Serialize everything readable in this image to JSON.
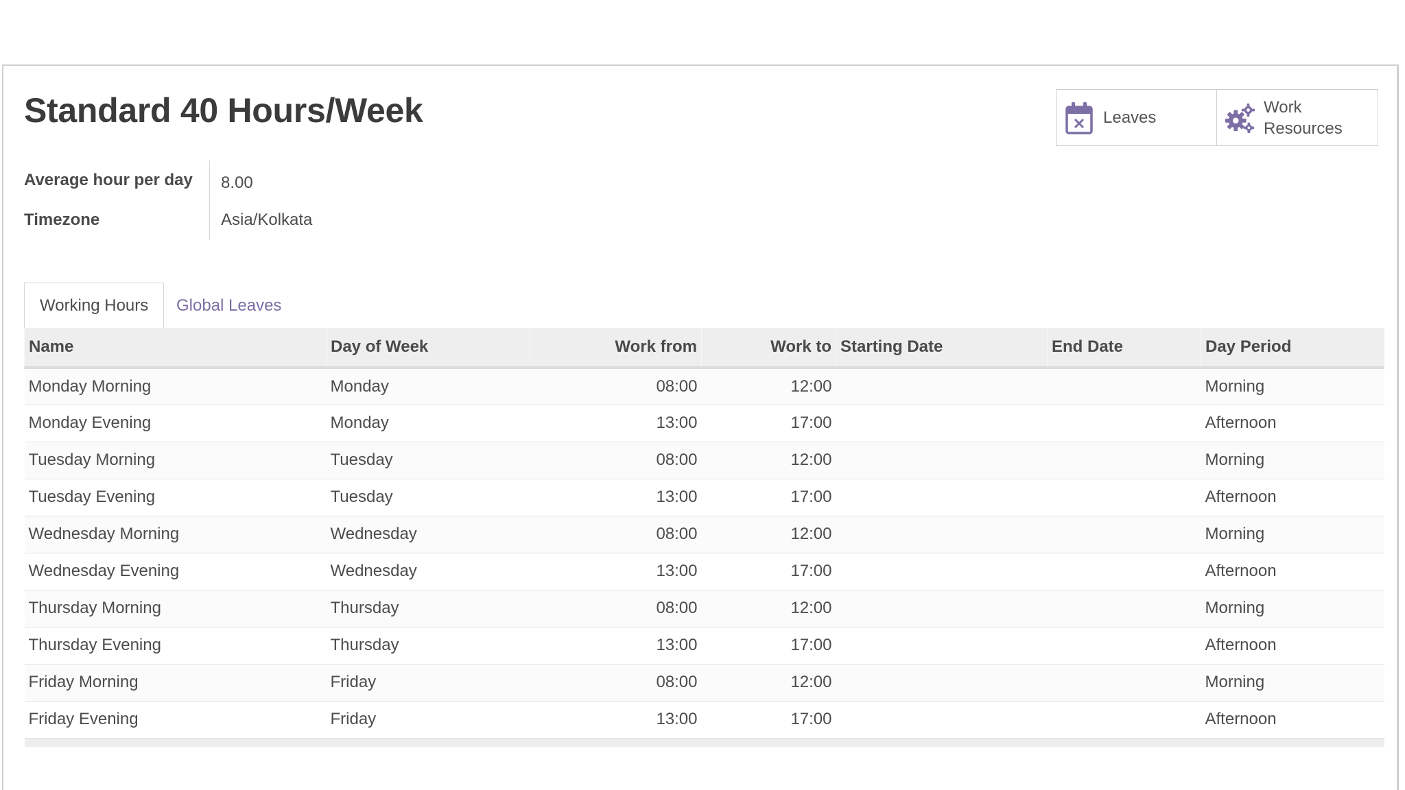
{
  "form": {
    "title": "Standard 40 Hours/Week",
    "fields": [
      {
        "label": "Average hour per day",
        "value": "8.00"
      },
      {
        "label": "Timezone",
        "value": "Asia/Kolkata"
      }
    ]
  },
  "buttons": {
    "leaves": {
      "label": "Leaves",
      "icon": "calendar-x-icon"
    },
    "resources": {
      "label_line1": "Work",
      "label_line2": "Resources",
      "icon": "gears-icon"
    }
  },
  "tabs": [
    {
      "label": "Working Hours",
      "active": true
    },
    {
      "label": "Global Leaves",
      "active": false
    }
  ],
  "table": {
    "columns": [
      "Name",
      "Day of Week",
      "Work from",
      "Work to",
      "Starting Date",
      "End Date",
      "Day Period"
    ],
    "rows": [
      [
        "Monday Morning",
        "Monday",
        "08:00",
        "12:00",
        "",
        "",
        "Morning"
      ],
      [
        "Monday Evening",
        "Monday",
        "13:00",
        "17:00",
        "",
        "",
        "Afternoon"
      ],
      [
        "Tuesday Morning",
        "Tuesday",
        "08:00",
        "12:00",
        "",
        "",
        "Morning"
      ],
      [
        "Tuesday Evening",
        "Tuesday",
        "13:00",
        "17:00",
        "",
        "",
        "Afternoon"
      ],
      [
        "Wednesday Morning",
        "Wednesday",
        "08:00",
        "12:00",
        "",
        "",
        "Morning"
      ],
      [
        "Wednesday Evening",
        "Wednesday",
        "13:00",
        "17:00",
        "",
        "",
        "Afternoon"
      ],
      [
        "Thursday Morning",
        "Thursday",
        "08:00",
        "12:00",
        "",
        "",
        "Morning"
      ],
      [
        "Thursday Evening",
        "Thursday",
        "13:00",
        "17:00",
        "",
        "",
        "Afternoon"
      ],
      [
        "Friday Morning",
        "Friday",
        "08:00",
        "12:00",
        "",
        "",
        "Morning"
      ],
      [
        "Friday Evening",
        "Friday",
        "13:00",
        "17:00",
        "",
        "",
        "Afternoon"
      ]
    ]
  },
  "colors": {
    "accent": "#7c6fa5",
    "icon": "#7c6fa5"
  }
}
